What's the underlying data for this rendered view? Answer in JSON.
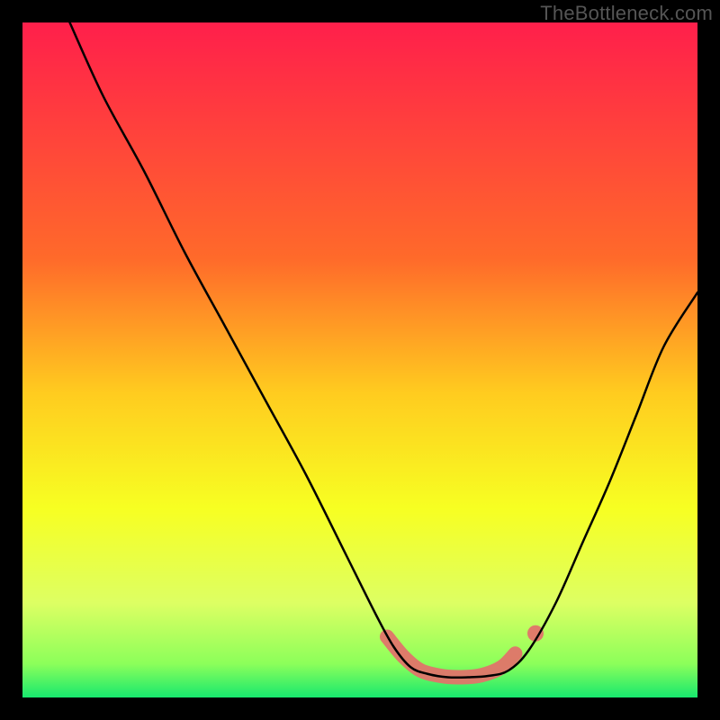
{
  "watermark": "TheBottleneck.com",
  "chart_data": {
    "type": "line",
    "title": "",
    "xlabel": "",
    "ylabel": "",
    "xlim": [
      0,
      100
    ],
    "ylim": [
      0,
      100
    ],
    "gradient_stops": [
      {
        "offset": 0,
        "color": "#ff1f4b"
      },
      {
        "offset": 35,
        "color": "#ff6a2a"
      },
      {
        "offset": 55,
        "color": "#ffcc1f"
      },
      {
        "offset": 72,
        "color": "#f7ff22"
      },
      {
        "offset": 86,
        "color": "#ddff63"
      },
      {
        "offset": 95,
        "color": "#8cff5a"
      },
      {
        "offset": 100,
        "color": "#17e86e"
      }
    ],
    "series": [
      {
        "name": "left-branch",
        "x": [
          7.0,
          12.0,
          18.0,
          24.0,
          30.0,
          36.0,
          42.0,
          48.0,
          52.5,
          55.0,
          57.5
        ],
        "y": [
          100.0,
          89.0,
          78.0,
          66.0,
          55.0,
          44.0,
          33.0,
          21.0,
          12.0,
          7.5,
          4.5
        ]
      },
      {
        "name": "valley-floor",
        "x": [
          57.5,
          60.0,
          63.0,
          66.0,
          69.0,
          72.0
        ],
        "y": [
          4.5,
          3.5,
          3.0,
          3.0,
          3.2,
          4.0
        ]
      },
      {
        "name": "right-branch",
        "x": [
          72.0,
          75.0,
          79.0,
          83.0,
          87.0,
          91.0,
          95.0,
          100.0
        ],
        "y": [
          4.0,
          7.0,
          14.0,
          23.0,
          32.0,
          42.0,
          52.0,
          60.0
        ]
      }
    ],
    "salmon_overlay": {
      "comment": "Thick salmon segment near the valley minimum",
      "x": [
        54.0,
        56.5,
        59.0,
        62.0,
        65.0,
        68.0,
        71.0,
        73.0
      ],
      "y": [
        9.0,
        6.0,
        4.0,
        3.2,
        3.0,
        3.3,
        4.5,
        6.5
      ],
      "dot": {
        "x": 76.0,
        "y": 9.5
      }
    },
    "curve_style": {
      "stroke": "#000000",
      "width": 2.5
    },
    "overlay_style": {
      "stroke": "#e0746a",
      "width": 16,
      "dot_radius": 9
    }
  }
}
